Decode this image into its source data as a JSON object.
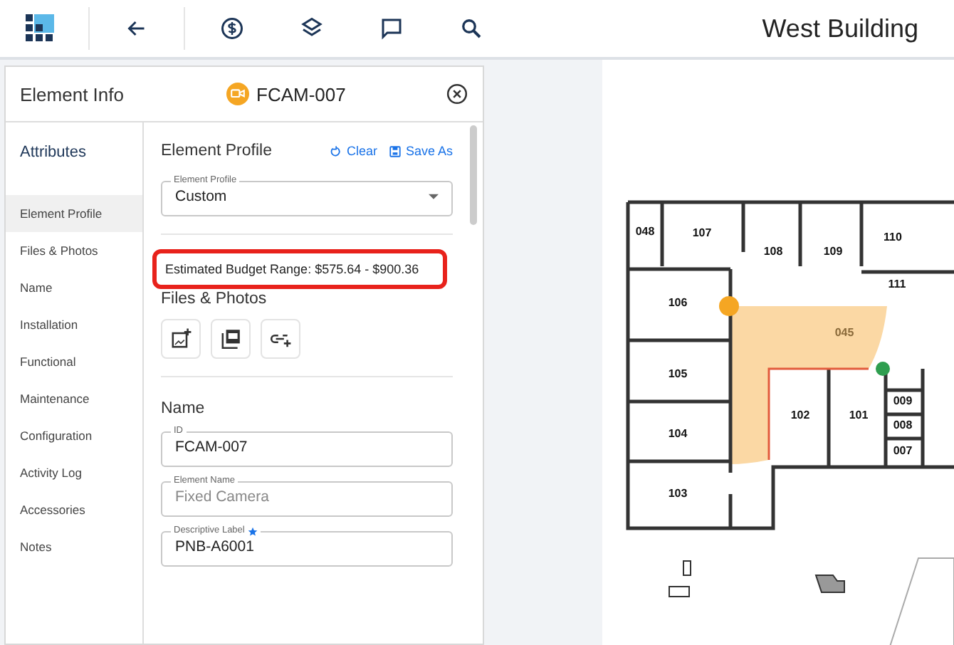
{
  "topbar": {
    "title": "West Building"
  },
  "panel": {
    "title": "Element Info",
    "element_id": "FCAM-007"
  },
  "sidebar": {
    "heading": "Attributes",
    "items": [
      {
        "label": "Element Profile",
        "selected": true
      },
      {
        "label": "Files & Photos",
        "selected": false
      },
      {
        "label": "Name",
        "selected": false
      },
      {
        "label": "Installation",
        "selected": false
      },
      {
        "label": "Functional",
        "selected": false
      },
      {
        "label": "Maintenance",
        "selected": false
      },
      {
        "label": "Configuration",
        "selected": false
      },
      {
        "label": "Activity Log",
        "selected": false
      },
      {
        "label": "Accessories",
        "selected": false
      },
      {
        "label": "Notes",
        "selected": false
      }
    ]
  },
  "profile": {
    "heading": "Element Profile",
    "clear": "Clear",
    "save_as": "Save As",
    "select": {
      "label": "Element Profile",
      "value": "Custom"
    },
    "budget": {
      "text": "Estimated Budget Range: $575.64 - $900.36",
      "highlighted": true
    }
  },
  "files": {
    "heading": "Files & Photos"
  },
  "name_section": {
    "heading": "Name",
    "fields": [
      {
        "label": "ID",
        "value": "FCAM-007",
        "required": false
      },
      {
        "label": "Element Name",
        "placeholder": "Fixed Camera",
        "required": false
      },
      {
        "label": "Descriptive Label",
        "value": "PNB-A6001",
        "required": true
      }
    ]
  },
  "map": {
    "rooms": [
      {
        "label": "048"
      },
      {
        "label": "107"
      },
      {
        "label": "108"
      },
      {
        "label": "109"
      },
      {
        "label": "110"
      },
      {
        "label": "111"
      },
      {
        "label": "106"
      },
      {
        "label": "045"
      },
      {
        "label": "105"
      },
      {
        "label": "102"
      },
      {
        "label": "101"
      },
      {
        "label": "009"
      },
      {
        "label": "008"
      },
      {
        "label": "007"
      },
      {
        "label": "104"
      },
      {
        "label": "103"
      }
    ]
  }
}
